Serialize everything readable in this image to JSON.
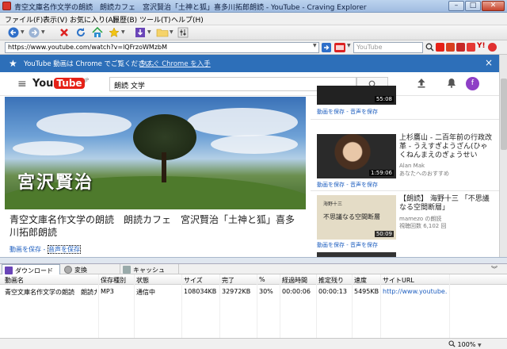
{
  "window": {
    "title": "青空文庫名作文学の朗読　朗読カフェ　宮沢賢治「土神と狐」喜多川拓郎朗読 - YouTube - Craving Explorer"
  },
  "menu": {
    "items": [
      {
        "label": "ファイル(F)"
      },
      {
        "label": "表示(V)"
      },
      {
        "label": "お気に入り(A)"
      },
      {
        "label": "履歴(B)"
      },
      {
        "label": "ツール(T)"
      },
      {
        "label": "ヘルプ(H)"
      }
    ]
  },
  "address": {
    "url": "https://www.youtube.com/watch?v=lQFrzoWMzbM",
    "search_placeholder": "YouTube"
  },
  "banner": {
    "text": "YouTube 動画は Chrome でご覧ください。",
    "link": "今すぐ Chrome を入手"
  },
  "youtube": {
    "logo_you": "You",
    "logo_tube": "Tube",
    "logo_region": "JP",
    "search_query": "朗読 文学",
    "avatar_letter": "f",
    "player_title": "宮沢賢治",
    "video_title": "青空文庫名作文学の朗読　朗読カフェ　宮沢賢治「土神と狐」喜多川拓郎朗読",
    "video_links": {
      "save": "動画を保存",
      "sep": " - ",
      "audio": "音声を保存"
    }
  },
  "related": [
    {
      "duration": "55:08",
      "links": "動画を保存 - 音声を保存"
    },
    {
      "title": "上杉鷹山 - 二百年前の行政改革 - うえすぎようざん(ひゃくねんまえのぎょうせい",
      "channel": "Alan Mak",
      "meta": "あなたへのおすすめ",
      "duration": "1:59:06",
      "links": "動画を保存 - 音声を保存"
    },
    {
      "title": "【朗読】 海野十三 「不思議なる空間断層」",
      "channel": "mamezo の朗読",
      "meta": "視聴回数 6,102 回",
      "duration": "50:09",
      "thumb_text": "不思議なる空間断層",
      "thumb_author": "海野十三",
      "links": "動画を保存 - 音声を保存"
    }
  ],
  "download_panel": {
    "tabs": [
      {
        "label": "ダウンロード",
        "active": true
      },
      {
        "label": "変換",
        "active": false
      },
      {
        "label": "キャッシュ",
        "active": false
      }
    ],
    "columns": [
      "動画名",
      "保存種別",
      "状態",
      "サイズ",
      "完了",
      "%",
      "経過時間",
      "推定残り",
      "速度",
      "サイトURL"
    ],
    "rows": [
      [
        "青空文庫名作文学の朗読　朗読カフ...",
        "MP3",
        "通信中",
        "108034KB",
        "32972KB",
        "30%",
        "00:00:06",
        "00:00:13",
        "5495KB",
        "http://www.youtube...."
      ]
    ]
  },
  "status": {
    "zoom": "100%"
  },
  "colors": {
    "banner": "#2d6fb9",
    "youtube_red": "#e62117",
    "link": "#2060c0"
  }
}
